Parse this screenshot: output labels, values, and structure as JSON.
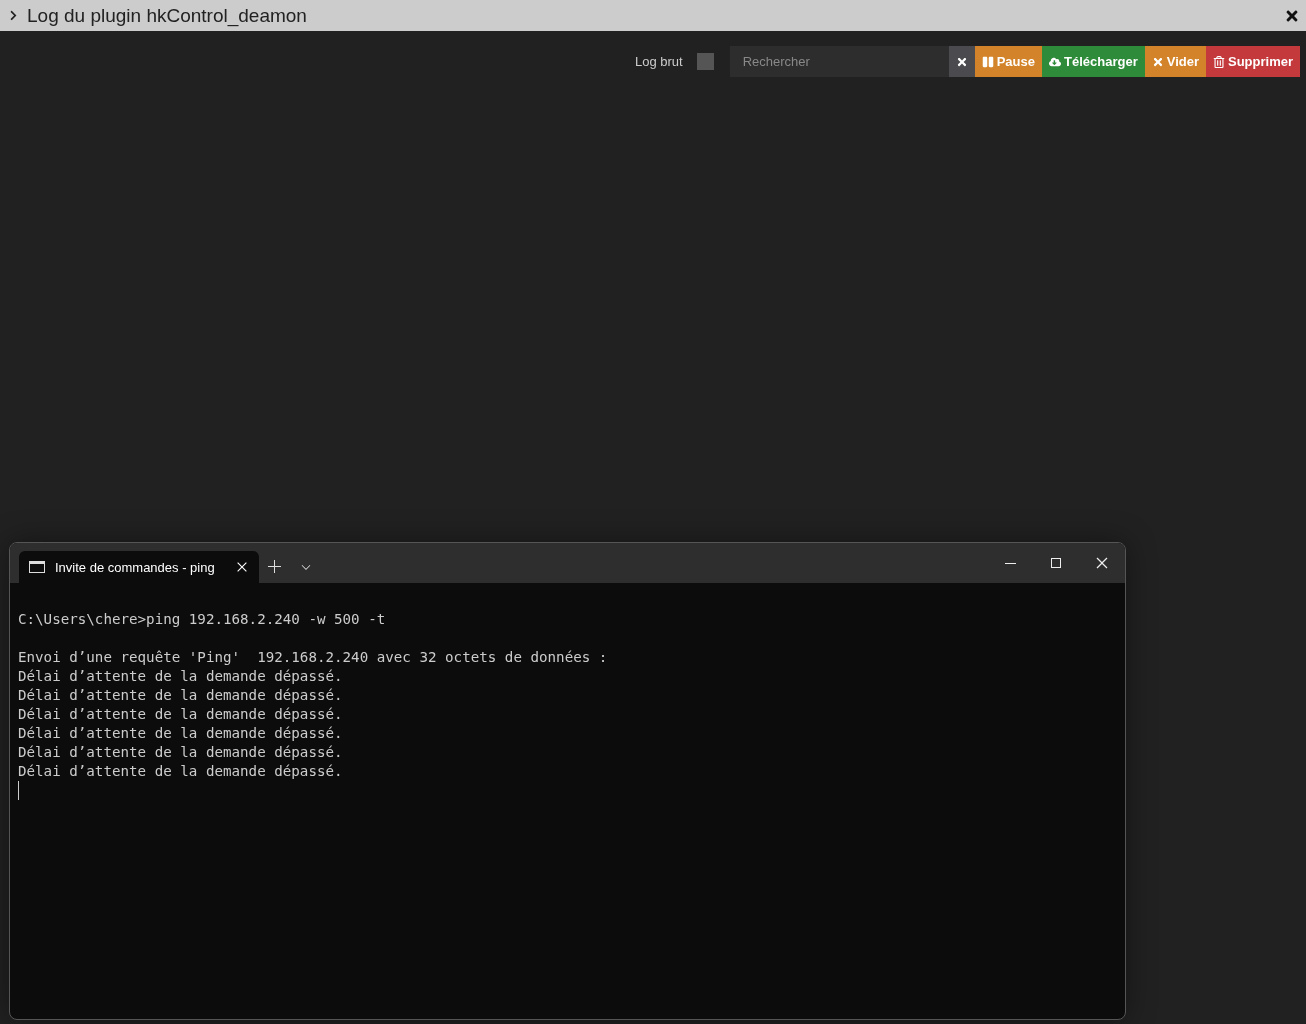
{
  "dialog": {
    "title": "Log du plugin hkControl_deamon"
  },
  "toolbar": {
    "raw_log": {
      "label": "Log brut",
      "checked": false
    },
    "search": {
      "placeholder": "Rechercher"
    },
    "buttons": [
      {
        "kind": "clear"
      },
      {
        "kind": "pause",
        "label": "Pause"
      },
      {
        "kind": "download",
        "label": "Télécharger"
      },
      {
        "kind": "empty",
        "label": "Vider"
      },
      {
        "kind": "delete",
        "label": "Supprimer"
      }
    ]
  },
  "terminal": {
    "tab": {
      "title": "Invite de commandes - ping ",
      "selected": true
    },
    "command": "C:\\Users\\chere>ping 192.168.2.240 -w 500 -t",
    "output": [
      "Envoi d’une requête 'Ping'  192.168.2.240 avec 32 octets de données :",
      "Délai d’attente de la demande dépassé.",
      "Délai d’attente de la demande dépassé.",
      "Délai d’attente de la demande dépassé.",
      "Délai d’attente de la demande dépassé.",
      "Délai d’attente de la demande dépassé.",
      "Délai d’attente de la demande dépassé."
    ]
  }
}
